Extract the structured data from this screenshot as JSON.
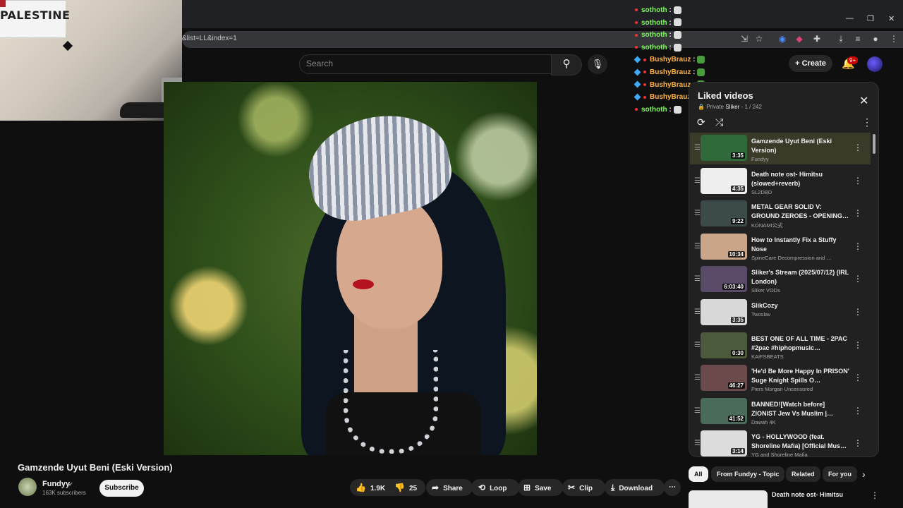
{
  "browser": {
    "url_fragment": "&list=LL&index=1",
    "window_controls": [
      "—",
      "❐",
      "✕"
    ]
  },
  "webcam": {
    "flag_text": "PALESTINE"
  },
  "header": {
    "search_placeholder": "Search",
    "create_label": "Create",
    "notifications_badge": "9+"
  },
  "chat": [
    {
      "user": "sothoth",
      "color": "#7cfc5a",
      "badge": "dot"
    },
    {
      "user": "sothoth",
      "color": "#7cfc5a",
      "badge": "dot"
    },
    {
      "user": "sothoth",
      "color": "#7cfc5a",
      "badge": "dot"
    },
    {
      "user": "sothoth",
      "color": "#7cfc5a",
      "badge": "dot"
    },
    {
      "user": "BushyBrauz",
      "color": "#ffb347",
      "badge": "gem"
    },
    {
      "user": "BushyBrauz",
      "color": "#ffb347",
      "badge": "gem"
    },
    {
      "user": "BushyBrauz",
      "color": "#ffb347",
      "badge": "gem"
    },
    {
      "user": "BushyBrauz",
      "color": "#ffb347",
      "badge": "gem"
    },
    {
      "user": "sothoth",
      "color": "#7cfc5a",
      "badge": "dot"
    }
  ],
  "video": {
    "title": "Gamzende Uyut Beni (Eski Version)",
    "channel": "Fundyy",
    "subscribers": "163K subscribers",
    "subscribe_label": "Subscribe",
    "likes": "1.9K",
    "dislikes": "25",
    "share_label": "Share",
    "loop_label": "Loop",
    "save_label": "Save",
    "clip_label": "Clip",
    "download_label": "Download"
  },
  "playlist": {
    "title": "Liked videos",
    "privacy": "Private",
    "owner": "Sliker",
    "position": "1 / 242",
    "items": [
      {
        "title": "Gamzende Uyut Beni (Eski Version)",
        "channel": "Fundyy",
        "duration": "3:35",
        "thumb": "#2f6a3a"
      },
      {
        "title": "Death note ost- Himitsu (slowed+reverb)",
        "channel": "SL2DBD",
        "duration": "4:35",
        "thumb": "#eeeeee"
      },
      {
        "title": "METAL GEAR SOLID V: GROUND ZEROES - OPENING…",
        "channel": "KONAMI公式",
        "duration": "9:22",
        "thumb": "#3c4a4a"
      },
      {
        "title": "How to Instantly Fix a Stuffy Nose",
        "channel": "SpineCare Decompression and …",
        "duration": "10:34",
        "thumb": "#c9a58a"
      },
      {
        "title": "Sliker's Stream (2025/07/12) (IRL London)",
        "channel": "Sliker VODs",
        "duration": "6:03:40",
        "thumb": "#5a4a6a"
      },
      {
        "title": "SlikCozy",
        "channel": "Twoslav",
        "duration": "3:35",
        "thumb": "#d8d8d8"
      },
      {
        "title": "BEST ONE OF ALL TIME - 2PAC #2pac #hiphopmusic…",
        "channel": "KAIFSBEATS",
        "duration": "0:30",
        "thumb": "#4a5a3a"
      },
      {
        "title": "'He'd Be More Happy In PRISON' Suge Knight Spills O…",
        "channel": "Piers Morgan Uncensored",
        "duration": "46:27",
        "thumb": "#6a4a4a"
      },
      {
        "title": "BANNED![Watch before] ZIONIST Jew Vs Muslim |…",
        "channel": "Dawah 4K",
        "duration": "41:52",
        "thumb": "#4a6a5a"
      },
      {
        "title": "YG - HOLLYWOOD (feat. Shoreline Mafia) [Official Mus…",
        "channel": "YG and Shoreline Mafia",
        "duration": "3:14",
        "thumb": "#dcdcdc"
      }
    ]
  },
  "chips": [
    "All",
    "From Fundyy - Topic",
    "Related",
    "For you"
  ],
  "related_next": {
    "title": "Death note ost- Himitsu"
  }
}
